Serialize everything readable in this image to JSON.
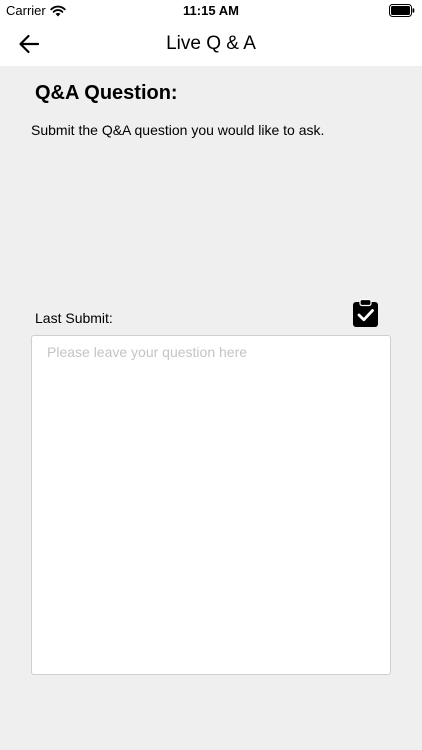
{
  "status_bar": {
    "carrier": "Carrier",
    "time": "11:15 AM",
    "icons": [
      "wifi-icon",
      "battery-icon"
    ]
  },
  "nav": {
    "title": "Live Q & A",
    "back_icon": "arrow-left-icon"
  },
  "content": {
    "heading": "Q&A Question:",
    "instructions": "Submit the Q&A question you would like to ask.",
    "last_submit_label": "Last Submit:",
    "submit_icon": "clipboard-check-icon",
    "question_input": {
      "value": "",
      "placeholder": "Please leave your question here"
    }
  },
  "colors": {
    "background": "#efefef",
    "bar_background": "#ffffff",
    "text": "#000000",
    "placeholder": "#c4c4c6",
    "input_border": "#cfcfcf"
  }
}
